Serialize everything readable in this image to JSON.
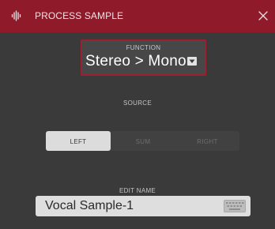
{
  "window": {
    "title": "PROCESS SAMPLE",
    "title_icon": "waveform-icon",
    "close_icon": "close-icon"
  },
  "function": {
    "label": "FUNCTION",
    "value": "Stereo > Mono",
    "dropdown_icon": "dropdown-arrow-icon"
  },
  "source": {
    "label": "SOURCE",
    "options": [
      "LEFT",
      "SUM",
      "RIGHT"
    ],
    "selected": "LEFT"
  },
  "edit_name": {
    "label": "EDIT NAME",
    "value": "Vocal Sample-1",
    "keyboard_icon": "keyboard-icon"
  },
  "colors": {
    "titlebar": "#8e1a2a",
    "background": "#3a3a3a",
    "accent_border": "#9e1f30",
    "active_segment": "#dcdcdc",
    "input_background": "#dedede"
  }
}
